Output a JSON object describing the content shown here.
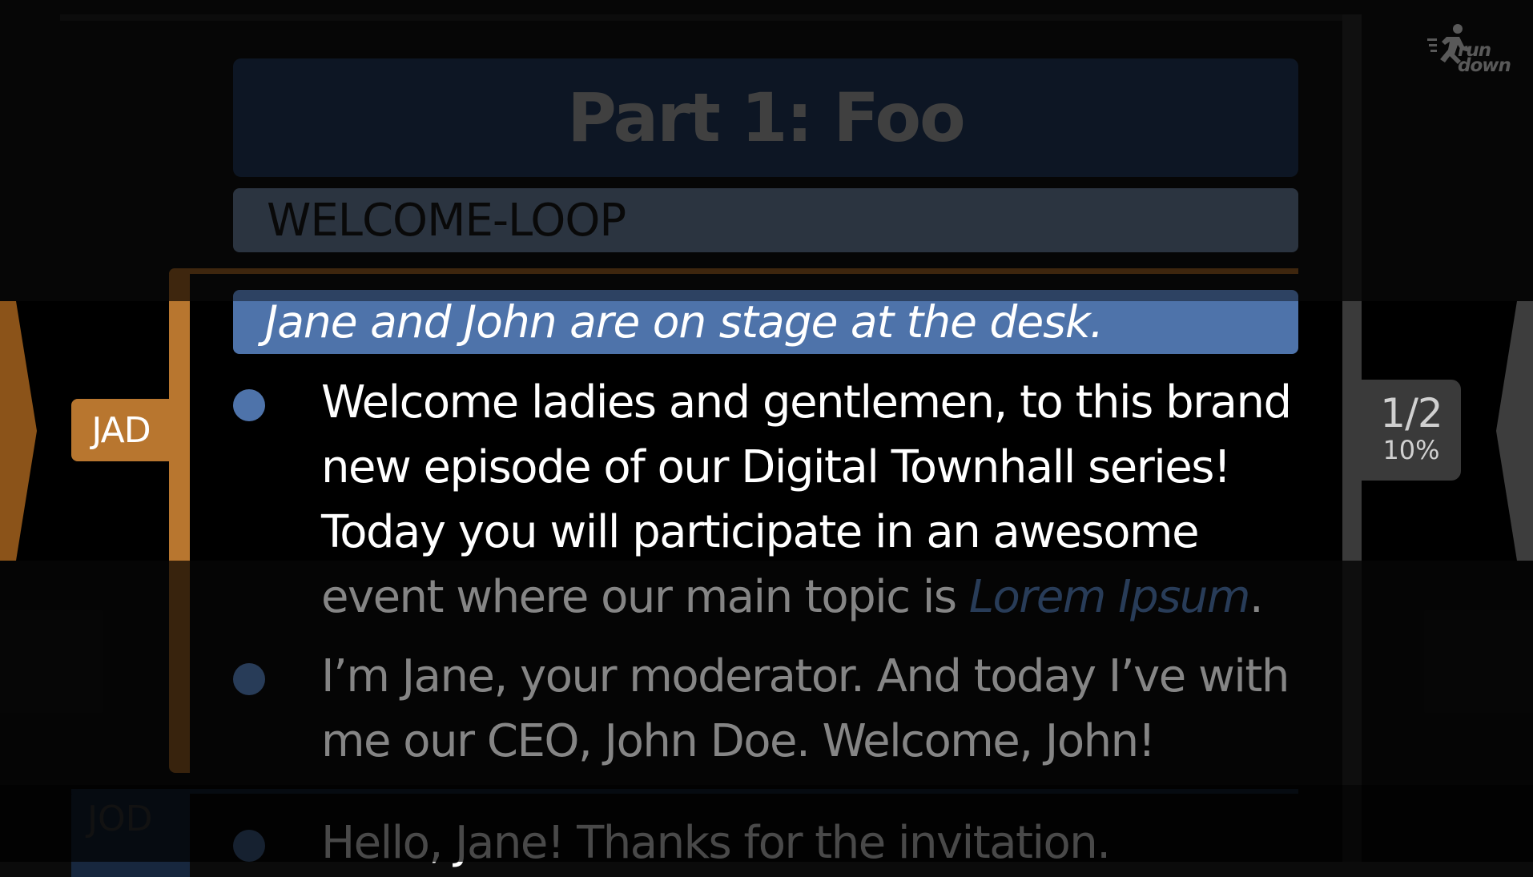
{
  "app": {
    "logo_text": "run\ndown"
  },
  "part": {
    "title": "Part 1: Foo"
  },
  "segment": {
    "slug": "WELCOME-LOOP"
  },
  "story": {
    "speaker": "JAD",
    "stage_direction": "Jane and John are on stage at the desk.",
    "paragraphs": [
      {
        "lines": [
          "Welcome ladies and gentlemen, to this brand",
          "new episode of our Digital Townhall series!",
          "Today you will participate in an awesome"
        ],
        "last_line_prefix": "event where our main topic is ",
        "last_line_emphasis": "Lorem Ipsum",
        "last_line_suffix": "."
      },
      {
        "lines": [
          "I’m Jane, your moderator. And today I’ve with",
          "me our CEO, John Doe. Welcome, John!"
        ]
      }
    ]
  },
  "next_story": {
    "speaker": "JOD",
    "first_line": "Hello, Jane! Thanks for the invitation."
  },
  "progress": {
    "page": "1/2",
    "percent": "10%"
  },
  "colors": {
    "accent_orange": "#b8762f",
    "accent_blue": "#4e73aa",
    "part_header_bg": "#17273e",
    "segment_bg": "#4b5a6f"
  }
}
